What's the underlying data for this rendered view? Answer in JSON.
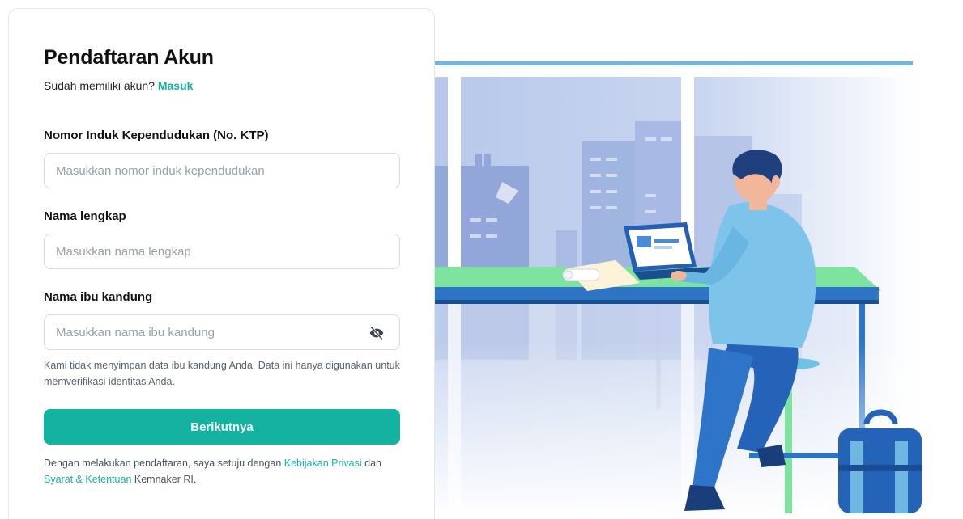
{
  "form": {
    "title": "Pendaftaran Akun",
    "login_prompt": "Sudah memiliki akun?",
    "login_link": "Masuk",
    "nik": {
      "label": "Nomor Induk Kependudukan (No. KTP)",
      "placeholder": "Masukkan nomor induk kependudukan",
      "value": ""
    },
    "full_name": {
      "label": "Nama lengkap",
      "placeholder": "Masukkan nama lengkap",
      "value": ""
    },
    "mother_name": {
      "label": "Nama ibu kandung",
      "placeholder": "Masukkan nama ibu kandung",
      "value": "",
      "toggle_icon": "eye-slash-icon"
    },
    "mother_hint": "Kami tidak menyimpan data ibu kandung Anda. Data ini hanya digunakan untuk memverifikasi identitas Anda.",
    "submit_label": "Berikutnya",
    "terms": {
      "prefix": "Dengan melakukan pendaftaran, saya setuju dengan",
      "privacy_link": "Kebijakan Privasi",
      "conjunction": "dan",
      "tos_link": "Syarat & Ketentuan",
      "suffix": "Kemnaker RI."
    }
  },
  "colors": {
    "accent": "#14b3a0",
    "input_border": "#d7dce1",
    "hint_text": "#5b636b"
  },
  "illustration": {
    "description_icon": "person-working-at-laptop-illustration"
  }
}
